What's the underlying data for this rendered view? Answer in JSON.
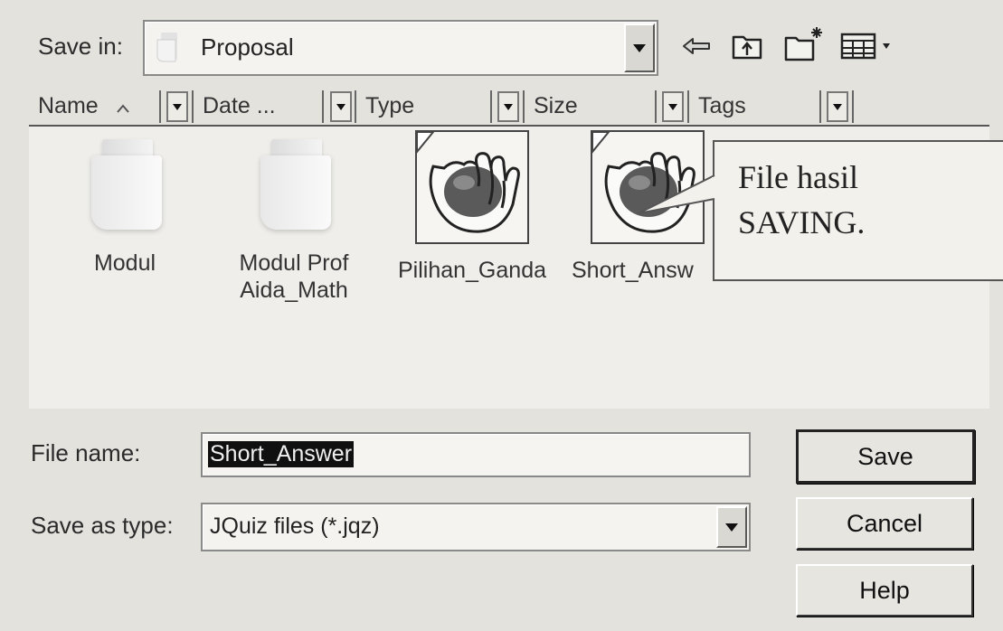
{
  "dialog": {
    "save_in_label": "Save in:",
    "save_in_value": "Proposal"
  },
  "toolbar": {
    "icons": [
      "back-arrow-icon",
      "up-folder-icon",
      "new-folder-icon",
      "view-menu-icon"
    ]
  },
  "columns": [
    {
      "label": "Name",
      "sort_indicator": "^"
    },
    {
      "label": "Date ..."
    },
    {
      "label": "Type"
    },
    {
      "label": "Size"
    },
    {
      "label": "Tags"
    }
  ],
  "files": [
    {
      "name_line1": "Modul",
      "name_line2": "",
      "icon": "folder-icon"
    },
    {
      "name_line1": "Modul Prof",
      "name_line2": "Aida_Math",
      "icon": "folder-icon"
    },
    {
      "name_line1": "Pilihan_Ganda",
      "name_line2": "",
      "icon": "hot-potatoes-icon"
    },
    {
      "name_line1": "Short_Answ",
      "name_line2": "",
      "icon": "hot-potatoes-icon"
    }
  ],
  "callout": {
    "line1": "File hasil",
    "line2": "SAVING."
  },
  "form": {
    "file_name_label": "File name:",
    "file_name_value": "Short_Answer",
    "save_as_type_label": "Save as type:",
    "save_as_type_value": "JQuiz files (*.jqz)"
  },
  "buttons": {
    "save": "Save",
    "cancel": "Cancel",
    "help": "Help"
  },
  "colors": {
    "background": "#e3e2dd",
    "selection": "#101010"
  }
}
